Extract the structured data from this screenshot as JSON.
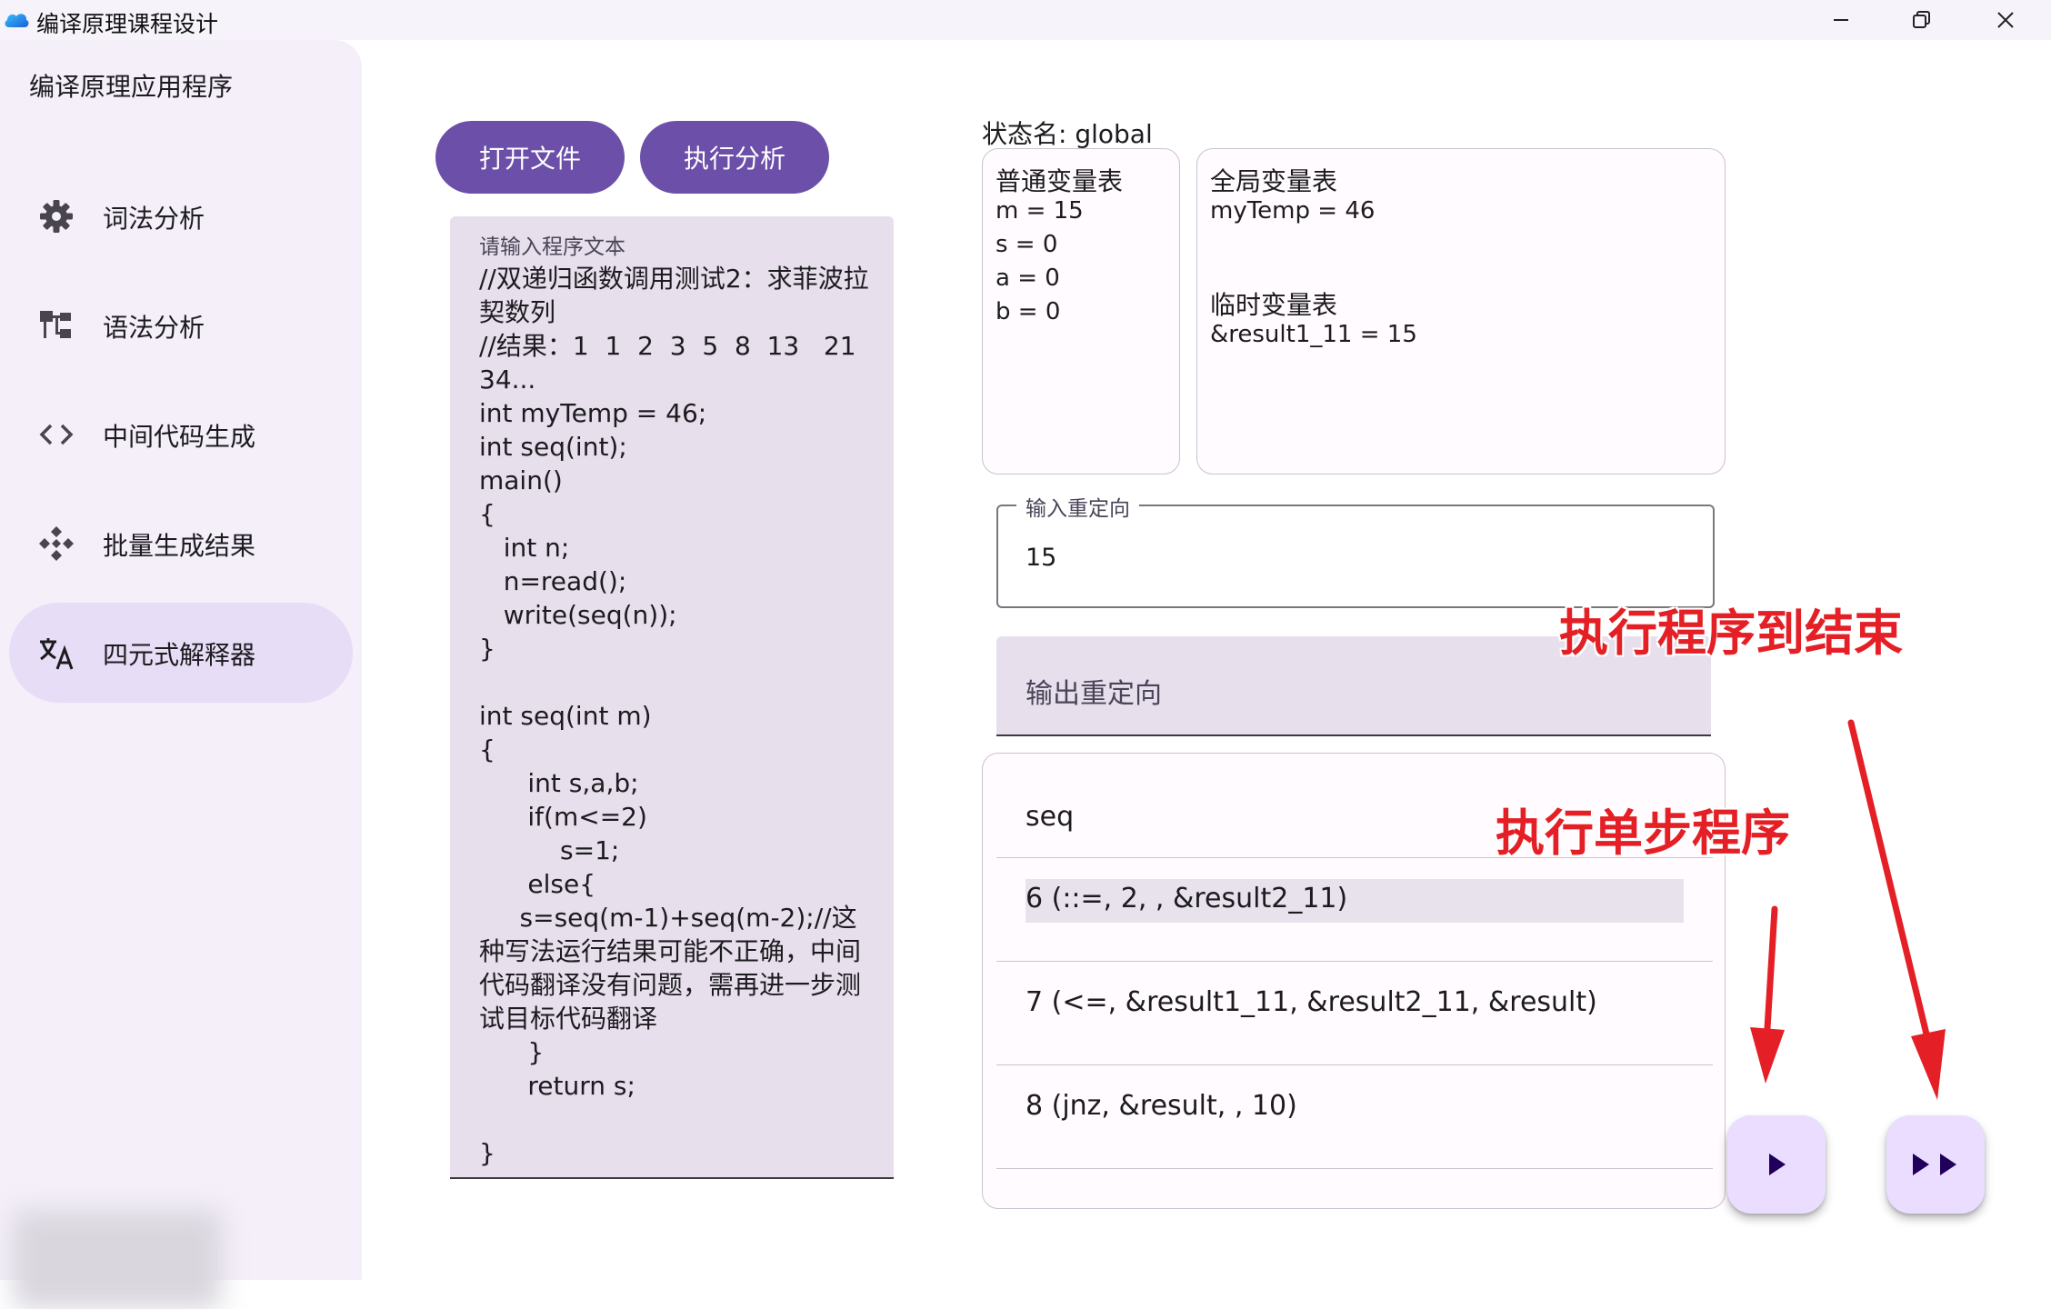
{
  "window": {
    "title": "编译原理课程设计"
  },
  "sidebar": {
    "title": "编译原理应用程序",
    "items": [
      {
        "label": "词法分析",
        "icon": "gear-icon"
      },
      {
        "label": "语法分析",
        "icon": "tree-structure-icon"
      },
      {
        "label": "中间代码生成",
        "icon": "code-brackets-icon"
      },
      {
        "label": "批量生成结果",
        "icon": "batch-diamond-icon"
      },
      {
        "label": "四元式解释器",
        "icon": "translate-icon",
        "active": true
      }
    ]
  },
  "toolbar": {
    "open_file_label": "打开文件",
    "run_analysis_label": "执行分析"
  },
  "editor": {
    "placeholder": "请输入程序文本",
    "content": "//双递归函数调用测试2：求菲波拉契数列\n//结果：1  1  2  3  5  8  13   21  34...\nint myTemp = 46;\nint seq(int);\nmain()\n{\n   int n;\n   n=read();\n   write(seq(n));\n}\n\nint seq(int m)\n{\n      int s,a,b;\n      if(m<=2)\n          s=1;\n      else{\n     s=seq(m-1)+seq(m-2);//这种写法运行结果可能不正确，中间代码翻译没有问题，需再进一步测试目标代码翻译\n      }\n      return s;\n\n}"
  },
  "state": {
    "label": "状态名: global",
    "local_table": {
      "title": "普通变量表",
      "vars": [
        "m = 15",
        "s = 0",
        "a = 0",
        "b = 0"
      ]
    },
    "global_table": {
      "title": "全局变量表",
      "vars": [
        "myTemp = 46"
      ]
    },
    "temp_table": {
      "title": "临时变量表",
      "vars": [
        "&result1_11 = 15"
      ]
    }
  },
  "input_redirect": {
    "label": "输入重定向",
    "value": "15"
  },
  "output_redirect": {
    "label": "输出重定向"
  },
  "quads": {
    "rows": [
      "seq",
      "6 (::=, 2, , &result2_11)",
      "7 (<=, &result1_11, &result2_11, &result)",
      "8 (jnz, &result, , 10)"
    ],
    "highlighted_index": 1
  },
  "annotations": {
    "run_to_end": "执行程序到结束",
    "step": "执行单步程序"
  },
  "colors": {
    "primary": "#6b4fa8",
    "nav_active": "#e8ddf6",
    "sidebar_bg": "#f4eff9",
    "field_fill": "#e7dfec",
    "fab_bg": "#eaddff",
    "annotation_red": "#e41f25"
  }
}
